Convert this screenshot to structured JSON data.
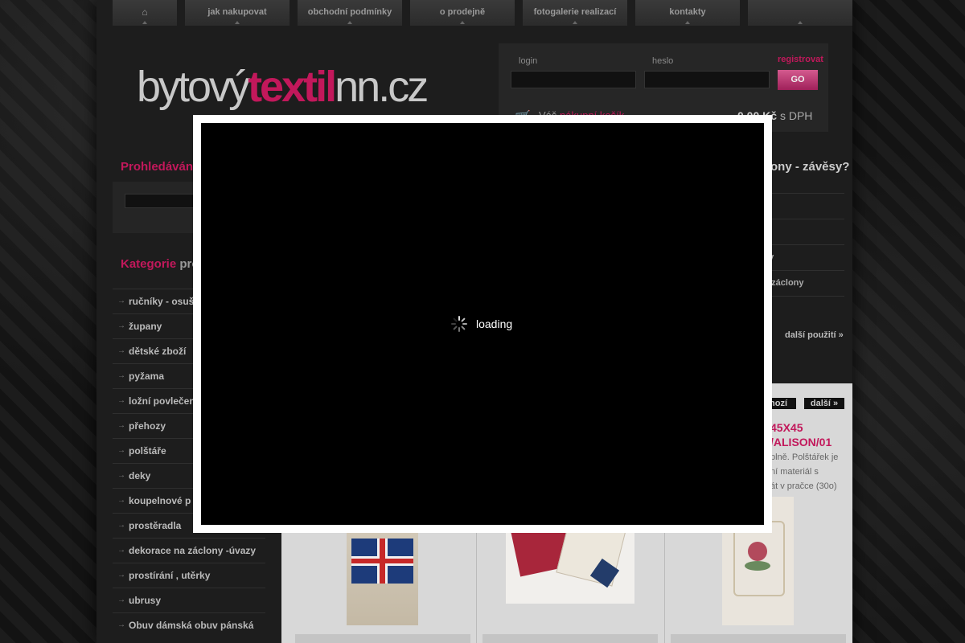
{
  "nav": {
    "home_icon": "home-icon",
    "items": [
      "jak nakupovat",
      "obchodní podmínky",
      "o prodejně",
      "fotogalerie realizací",
      "kontakty"
    ]
  },
  "logo": {
    "part1": "bytový",
    "part2": "textil",
    "part3": "nn.cz"
  },
  "login": {
    "login_label": "login",
    "password_label": "heslo",
    "register_link": "registrovat",
    "go_button": "GO"
  },
  "cart": {
    "prefix": "Váš",
    "link": "nákupní košík",
    "price": "0,00 Kč",
    "price_suffix": "s DPH"
  },
  "search": {
    "title": "Prohledávání"
  },
  "categories": {
    "title_highlight": "Kategorie",
    "title_rest": "pro",
    "items": [
      "ručníky - osuš",
      "župany",
      "dětské zboží",
      "pyžama",
      "ložní povlečen",
      "přehozy",
      "polštáře",
      "deky",
      "koupelnové p",
      "prostěradla",
      "dekorace na záclony -úvazy",
      "prostírání , utěrky",
      "ubrusy",
      "Obuv dámská obuv pánská"
    ]
  },
  "right": {
    "title": "ony - závěsy?",
    "items": [
      "",
      "",
      "sy",
      "é záclony",
      ""
    ],
    "more": "další použití »"
  },
  "products": {
    "prev": "hozí",
    "next": "další »",
    "title": "45X45\n/ALISON/01",
    "desc_lines": [
      "plně. Polštářek je",
      "ní materiál s",
      "át v pračce (30o)"
    ]
  },
  "overlay": {
    "loading_text": "loading"
  },
  "colors": {
    "accent": "#c2185b",
    "background": "#141414",
    "panel": "#262626"
  }
}
